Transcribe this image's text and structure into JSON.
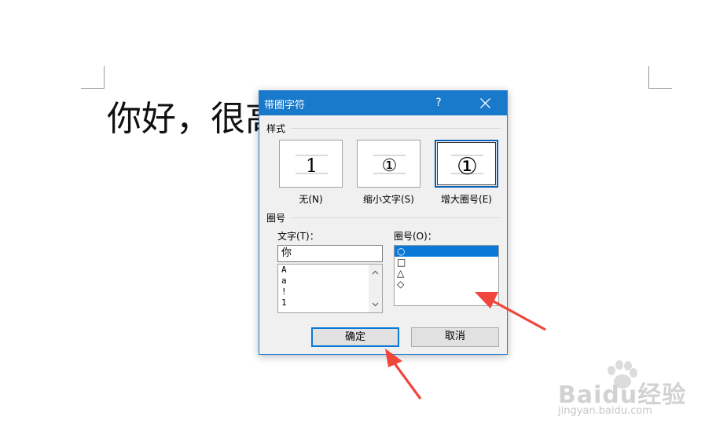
{
  "document": {
    "text": "你好，很高"
  },
  "dialog": {
    "title": "带圈字符",
    "help": "?",
    "style_group": "样式",
    "styles": [
      {
        "glyph": "1",
        "label": "无(N)"
      },
      {
        "glyph": "①",
        "label": "缩小文字(S)"
      },
      {
        "glyph": "①",
        "label": "增大圈号(E)",
        "selected": true
      }
    ],
    "enclosure_group": "圈号",
    "text_label": "文字(T)：",
    "text_value": "你",
    "text_options": [
      "A",
      "a",
      "!",
      "1"
    ],
    "enclosure_label": "圈号(O)：",
    "enclosures": [
      "○",
      "□",
      "△",
      "◇"
    ],
    "selected_enclosure": "○",
    "ok_label": "确定",
    "cancel_label": "取消"
  },
  "colors": {
    "titlebar": "#1979ca",
    "selection": "#0a78d7",
    "annotation_arrow": "#f0463c"
  },
  "watermark": {
    "logo_text": "Baidu经验",
    "url": "jingyan.baidu.com"
  }
}
